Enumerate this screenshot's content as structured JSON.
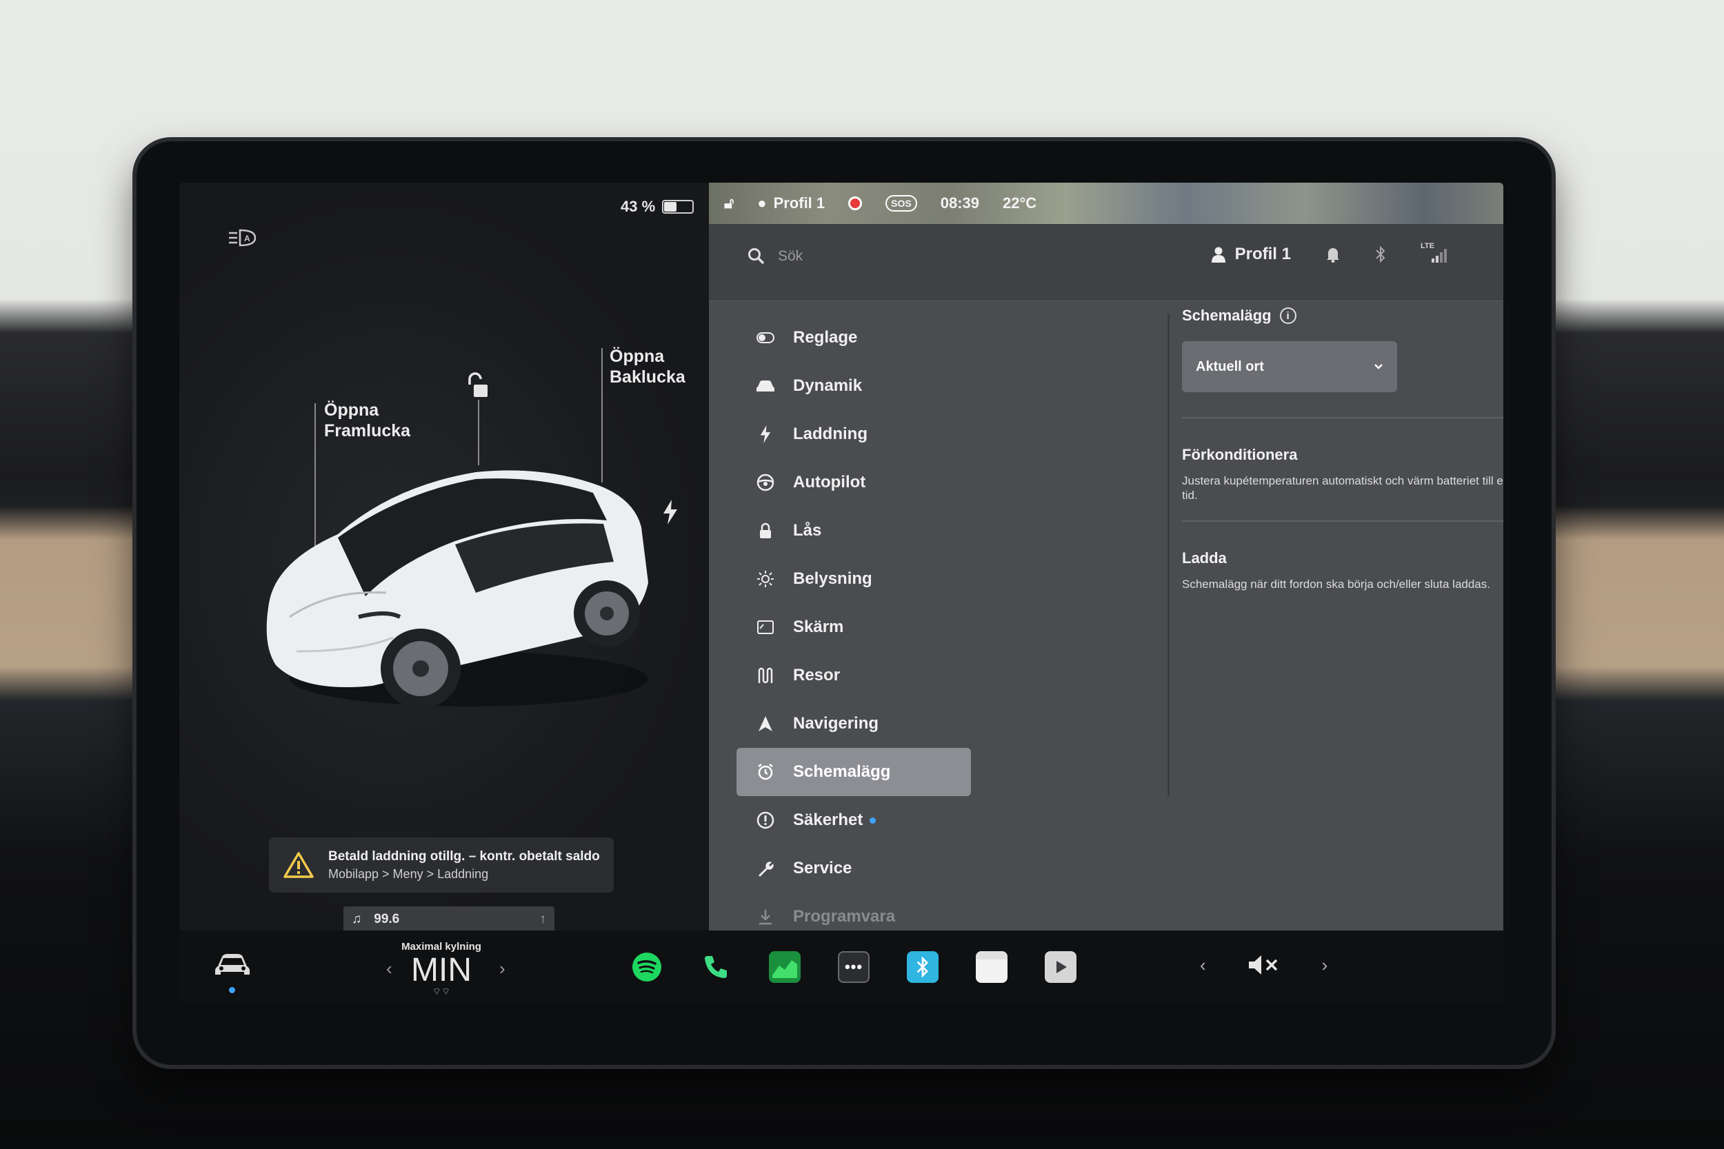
{
  "status": {
    "battery_percent": "43 %",
    "battery_level": 0.43,
    "profile": "Profil 1",
    "time": "08:39",
    "temperature": "22°C",
    "sos": "SOS"
  },
  "car": {
    "front_trunk": [
      "Öppna",
      "Framlucka"
    ],
    "rear_trunk": [
      "Öppna",
      "Baklucka"
    ]
  },
  "alert": {
    "title": "Betald laddning otillg. – kontr. obetalt saldo",
    "path": "Mobilapp > Meny > Laddning"
  },
  "media": {
    "station": "99.6"
  },
  "search": {
    "placeholder": "Sök"
  },
  "header": {
    "profile": "Profil 1",
    "network": "LTE"
  },
  "nav": {
    "items": [
      {
        "label": "Reglage",
        "icon": "toggle-icon"
      },
      {
        "label": "Dynamik",
        "icon": "car-icon"
      },
      {
        "label": "Laddning",
        "icon": "bolt-icon"
      },
      {
        "label": "Autopilot",
        "icon": "steering-wheel-icon"
      },
      {
        "label": "Lås",
        "icon": "lock-icon"
      },
      {
        "label": "Belysning",
        "icon": "sun-icon"
      },
      {
        "label": "Skärm",
        "icon": "display-icon"
      },
      {
        "label": "Resor",
        "icon": "trips-icon"
      },
      {
        "label": "Navigering",
        "icon": "navigation-icon"
      },
      {
        "label": "Schemalägg",
        "icon": "alarm-clock-icon"
      },
      {
        "label": "Säkerhet",
        "icon": "alert-circle-icon"
      },
      {
        "label": "Service",
        "icon": "wrench-icon"
      },
      {
        "label": "Programvara",
        "icon": "download-icon"
      }
    ],
    "active": "Schemalägg"
  },
  "schedule": {
    "title": "Schemalägg",
    "location": "Aktuell ort",
    "precondition_title": "Förkonditionera",
    "precondition_desc": "Justera kupétemperaturen automatiskt och värm batteriet till en angiven tid.",
    "charge_title": "Ladda",
    "charge_desc": "Schemalägg när ditt fordon ska börja och/eller sluta laddas."
  },
  "dock": {
    "climate_label": "Maximal kylning",
    "climate_value": "MIN"
  },
  "colors": {
    "accent_blue": "#3ea4ff",
    "active_nav": "#8c8e93",
    "spotify_green": "#1ed760",
    "phone_green": "#3ddc84"
  }
}
